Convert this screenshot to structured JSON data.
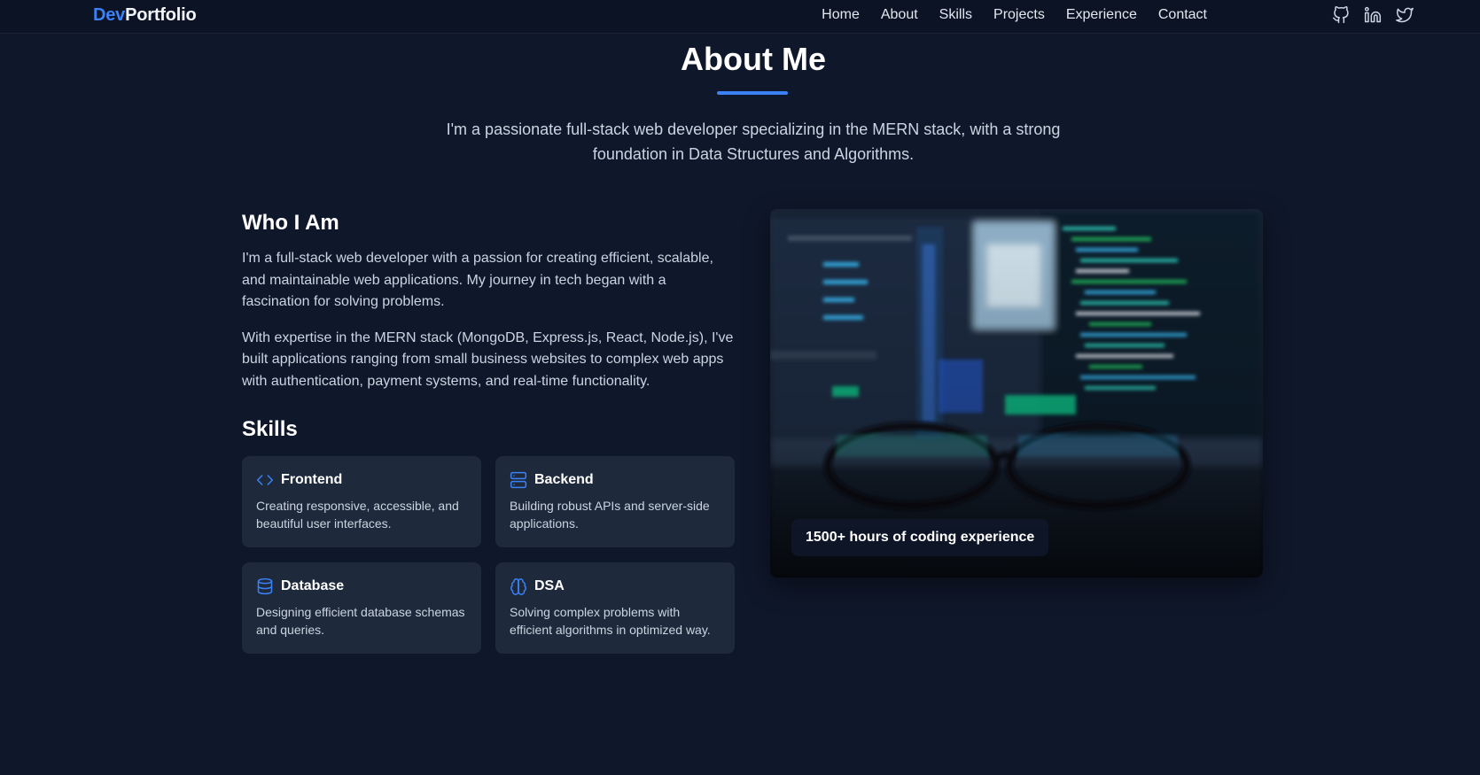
{
  "brand": {
    "accent": "Dev",
    "rest": "Portfolio"
  },
  "nav": {
    "links": [
      "Home",
      "About",
      "Skills",
      "Projects",
      "Experience",
      "Contact"
    ],
    "socials": [
      "github-icon",
      "linkedin-icon",
      "twitter-icon"
    ]
  },
  "about": {
    "title": "About Me",
    "intro": "I'm a passionate full-stack web developer specializing in the MERN stack, with a strong foundation in Data Structures and Algorithms.",
    "who_title": "Who I Am",
    "paragraphs": [
      "I'm a full-stack web developer with a passion for creating efficient, scalable, and maintainable web applications. My journey in tech began with a fascination for solving problems.",
      "With expertise in the MERN stack (MongoDB, Express.js, React, Node.js), I've built applications ranging from small business websites to complex web apps with authentication, payment systems, and real-time functionality."
    ],
    "skills_title": "Skills",
    "skills": [
      {
        "icon": "code-icon",
        "name": "Frontend",
        "desc": "Creating responsive, accessible, and beautiful user interfaces."
      },
      {
        "icon": "server-icon",
        "name": "Backend",
        "desc": "Building robust APIs and server-side applications."
      },
      {
        "icon": "database-icon",
        "name": "Database",
        "desc": "Designing efficient database schemas and queries."
      },
      {
        "icon": "brain-icon",
        "name": "DSA",
        "desc": "Solving complex problems with efficient algorithms in optimized way."
      }
    ],
    "image_badge": "1500+ hours of coding experience"
  },
  "colors": {
    "background": "#0f172a",
    "accent": "#3b82f6",
    "card": "#1e293b"
  }
}
